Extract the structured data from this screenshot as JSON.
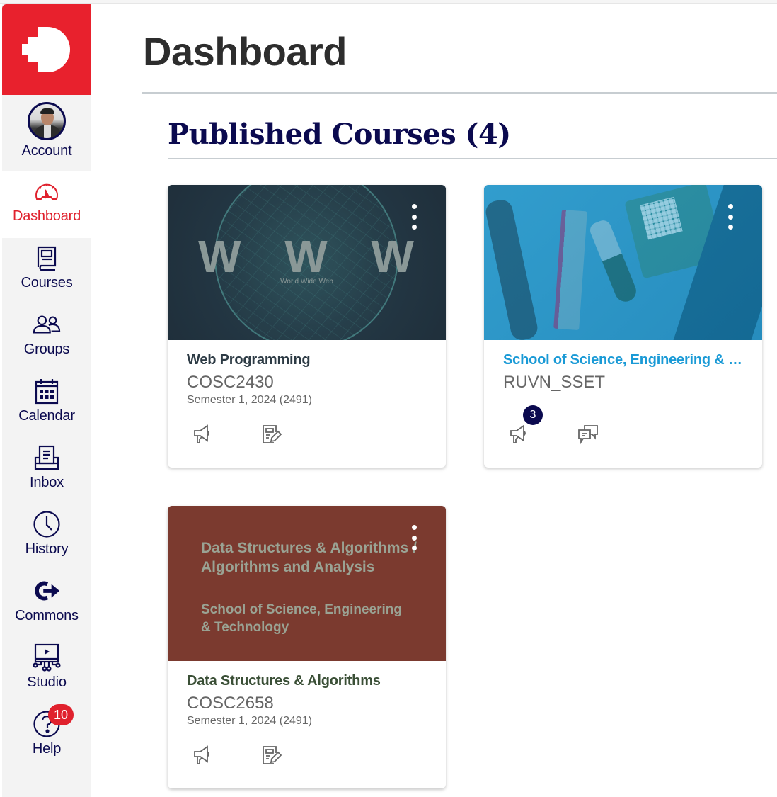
{
  "brand": {
    "color": "#e8212d",
    "logo_icon": "canvas-logo-icon"
  },
  "sidebar": {
    "items": [
      {
        "label": "Account",
        "icon": "avatar",
        "active": false
      },
      {
        "label": "Dashboard",
        "icon": "dashboard-gauge-icon",
        "active": true
      },
      {
        "label": "Courses",
        "icon": "book-icon",
        "active": false
      },
      {
        "label": "Groups",
        "icon": "users-icon",
        "active": false
      },
      {
        "label": "Calendar",
        "icon": "calendar-icon",
        "active": false
      },
      {
        "label": "Inbox",
        "icon": "inbox-icon",
        "active": false
      },
      {
        "label": "History",
        "icon": "clock-icon",
        "active": false
      },
      {
        "label": "Commons",
        "icon": "commons-icon",
        "active": false
      },
      {
        "label": "Studio",
        "icon": "studio-icon",
        "active": false
      },
      {
        "label": "Help",
        "icon": "help-icon",
        "active": false,
        "badge": "10"
      }
    ]
  },
  "header": {
    "title": "Dashboard"
  },
  "section": {
    "title": "Published Courses (4)"
  },
  "courses": [
    {
      "name": "Web Programming",
      "code": "COSC2430",
      "term": "Semester 1, 2024 (2491)",
      "name_color": "#2d3b45",
      "hero": {
        "headline": "W W W",
        "subline": "World Wide Web"
      },
      "actions": [
        {
          "icon": "announcements-icon",
          "badge": null
        },
        {
          "icon": "assignments-icon",
          "badge": null
        }
      ]
    },
    {
      "name": "School of Science, Engineering & T...",
      "code": "RUVN_SSET",
      "term": "",
      "name_color": "#1a9ad6",
      "actions": [
        {
          "icon": "announcements-icon",
          "badge": "3"
        },
        {
          "icon": "discussions-icon",
          "badge": null
        }
      ]
    },
    {
      "name": "Data Structures & Algorithms",
      "code": "COSC2658",
      "term": "Semester 1, 2024 (2491)",
      "name_color": "#3a4f36",
      "hero": {
        "title_line1": "Data Structures & Algorithms /",
        "title_line2": "Algorithms and Analysis",
        "sub_line1": "School of Science, Engineering",
        "sub_line2": "& Technology"
      },
      "actions": [
        {
          "icon": "announcements-icon",
          "badge": null
        },
        {
          "icon": "assignments-icon",
          "badge": null
        }
      ]
    }
  ]
}
